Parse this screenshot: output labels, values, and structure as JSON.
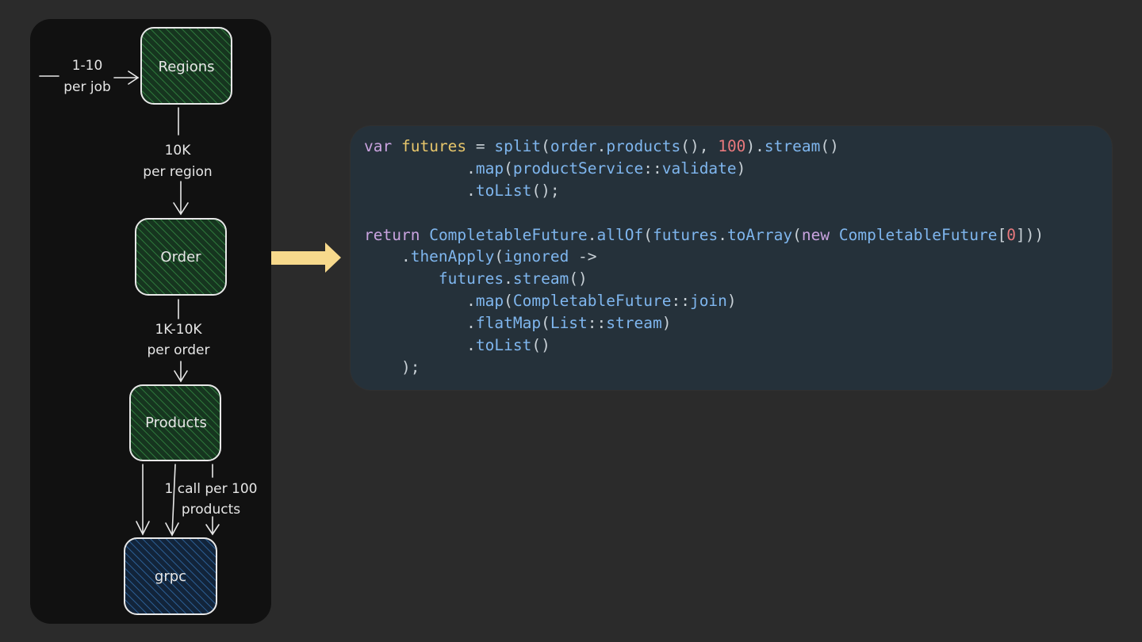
{
  "diagram": {
    "nodes": [
      {
        "id": "regions",
        "label": "Regions",
        "kind": "green"
      },
      {
        "id": "order",
        "label": "Order",
        "kind": "green"
      },
      {
        "id": "products",
        "label": "Products",
        "kind": "green"
      },
      {
        "id": "grpc",
        "label": "grpc",
        "kind": "blue"
      }
    ],
    "edges": [
      {
        "from": "input",
        "to": "regions",
        "label_lines": [
          "1-10",
          "per job"
        ]
      },
      {
        "from": "regions",
        "to": "order",
        "label_lines": [
          "10K",
          "per region"
        ]
      },
      {
        "from": "order",
        "to": "products",
        "label_lines": [
          "1K-10K",
          "per order"
        ]
      },
      {
        "from": "products",
        "to": "grpc",
        "label_lines": [
          "1 call per 100",
          "products"
        ]
      }
    ],
    "colors": {
      "green_fill": "#16351f",
      "green_hatch": "#2f7a3c",
      "blue_fill": "#12243a",
      "blue_hatch": "#2c5f94",
      "stroke": "#e8e8e8",
      "arrow": "#f7d98c"
    }
  },
  "code": {
    "lines": [
      [
        [
          "kw",
          "var"
        ],
        [
          "p",
          " "
        ],
        [
          "var",
          "futures"
        ],
        [
          "p",
          " = "
        ],
        [
          "fn",
          "split"
        ],
        [
          "p",
          "("
        ],
        [
          "fn",
          "order"
        ],
        [
          "p",
          "."
        ],
        [
          "fn",
          "products"
        ],
        [
          "p",
          "(), "
        ],
        [
          "num",
          "100"
        ],
        [
          "p",
          ")."
        ],
        [
          "fn",
          "stream"
        ],
        [
          "p",
          "()"
        ]
      ],
      [
        [
          "p",
          "           ."
        ],
        [
          "fn",
          "map"
        ],
        [
          "p",
          "("
        ],
        [
          "fn",
          "productService"
        ],
        [
          "p",
          "::"
        ],
        [
          "fn",
          "validate"
        ],
        [
          "p",
          ")"
        ]
      ],
      [
        [
          "p",
          "           ."
        ],
        [
          "fn",
          "toList"
        ],
        [
          "p",
          "();"
        ]
      ],
      [
        [
          "p",
          ""
        ]
      ],
      [
        [
          "kw",
          "return"
        ],
        [
          "p",
          " "
        ],
        [
          "fn",
          "CompletableFuture"
        ],
        [
          "p",
          "."
        ],
        [
          "fn",
          "allOf"
        ],
        [
          "p",
          "("
        ],
        [
          "fn",
          "futures"
        ],
        [
          "p",
          "."
        ],
        [
          "fn",
          "toArray"
        ],
        [
          "p",
          "("
        ],
        [
          "kw",
          "new"
        ],
        [
          "p",
          " "
        ],
        [
          "fn",
          "CompletableFuture"
        ],
        [
          "p",
          "["
        ],
        [
          "num",
          "0"
        ],
        [
          "p",
          "]))"
        ]
      ],
      [
        [
          "p",
          "    ."
        ],
        [
          "fn",
          "thenApply"
        ],
        [
          "p",
          "("
        ],
        [
          "fn",
          "ignored"
        ],
        [
          "p",
          " ->"
        ]
      ],
      [
        [
          "p",
          "        "
        ],
        [
          "fn",
          "futures"
        ],
        [
          "p",
          "."
        ],
        [
          "fn",
          "stream"
        ],
        [
          "p",
          "()"
        ]
      ],
      [
        [
          "p",
          "           ."
        ],
        [
          "fn",
          "map"
        ],
        [
          "p",
          "("
        ],
        [
          "fn",
          "CompletableFuture"
        ],
        [
          "p",
          "::"
        ],
        [
          "fn",
          "join"
        ],
        [
          "p",
          ")"
        ]
      ],
      [
        [
          "p",
          "           ."
        ],
        [
          "fn",
          "flatMap"
        ],
        [
          "p",
          "("
        ],
        [
          "fn",
          "List"
        ],
        [
          "p",
          "::"
        ],
        [
          "fn",
          "stream"
        ],
        [
          "p",
          ")"
        ]
      ],
      [
        [
          "p",
          "           ."
        ],
        [
          "fn",
          "toList"
        ],
        [
          "p",
          "()"
        ]
      ],
      [
        [
          "p",
          "    );"
        ]
      ]
    ]
  }
}
